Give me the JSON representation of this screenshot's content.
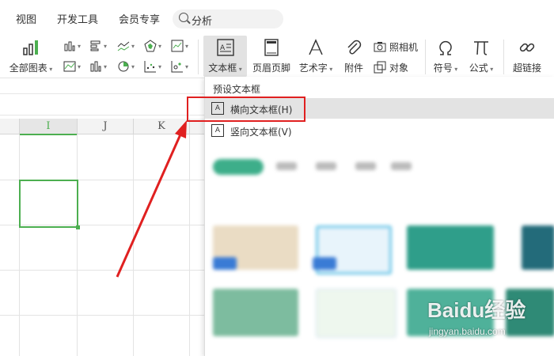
{
  "menu": {
    "tabs": [
      "视图",
      "开发工具",
      "会员专享"
    ],
    "search_label": "分析"
  },
  "toolbar": {
    "all_charts": "全部图表",
    "textbox": "文本框",
    "header_footer": "页眉页脚",
    "art_text": "艺术字",
    "attachment": "附件",
    "camera": "照相机",
    "object": "对象",
    "symbol": "符号",
    "formula": "公式",
    "hyperlink": "超链接"
  },
  "columns": [
    "I",
    "J",
    "K"
  ],
  "dropdown": {
    "title": "预设文本框",
    "items": [
      "横向文本框(H)",
      "竖向文本框(V)"
    ]
  },
  "watermark": {
    "brand": "Baidu经验",
    "url": "jingyan.baidu.com"
  },
  "colors": {
    "accent_green": "#4caf50",
    "annotation_red": "#e02020"
  }
}
